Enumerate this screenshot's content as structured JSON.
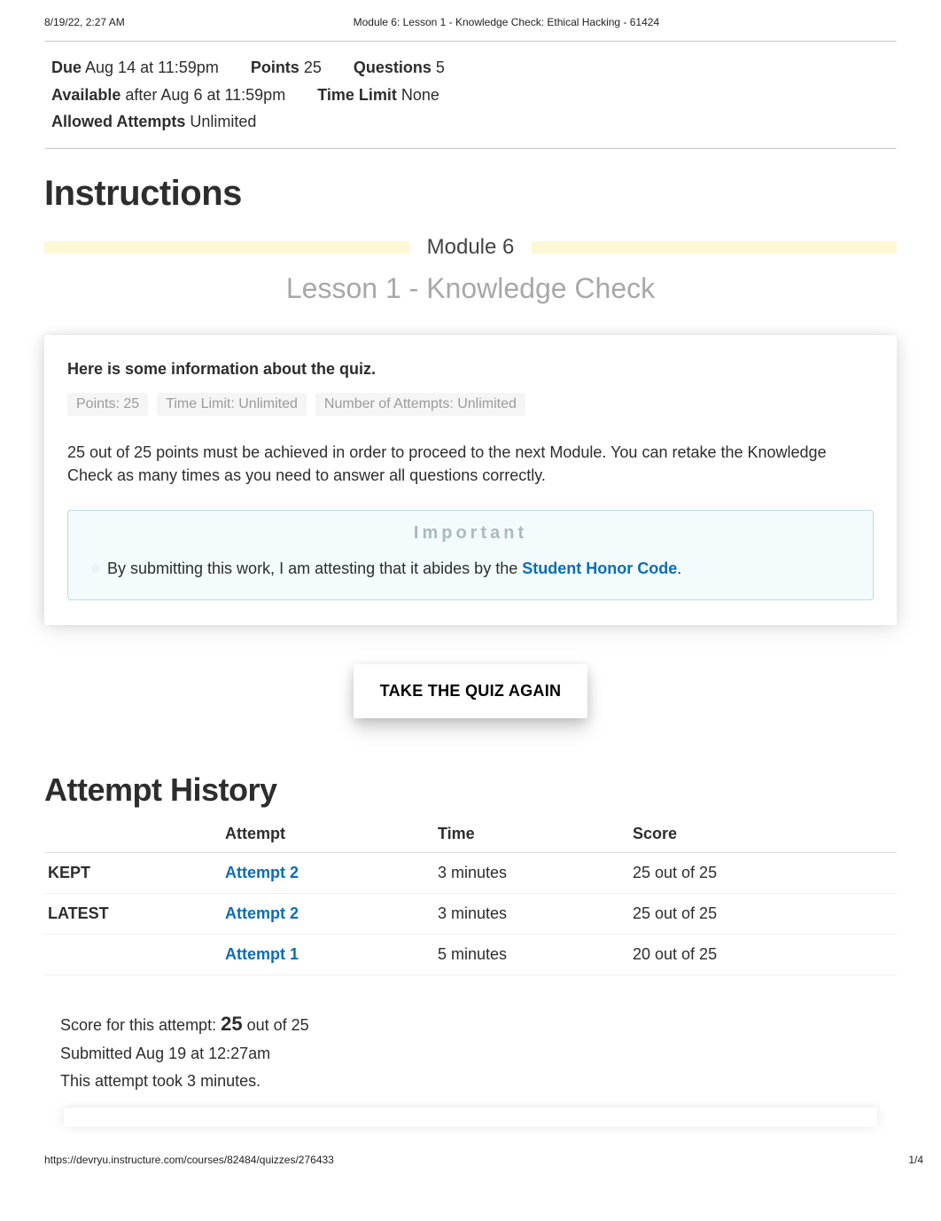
{
  "print": {
    "datetime": "8/19/22, 2:27 AM",
    "title": "Module 6: Lesson 1 - Knowledge Check: Ethical Hacking - 61424",
    "url": "https://devryu.instructure.com/courses/82484/quizzes/276433",
    "page": "1/4"
  },
  "meta": {
    "due_label": "Due",
    "due_value": "Aug 14 at 11:59pm",
    "points_label": "Points",
    "points_value": "25",
    "questions_label": "Questions",
    "questions_value": "5",
    "available_label": "Available",
    "available_value": "after Aug 6 at 11:59pm",
    "timelimit_label": "Time Limit",
    "timelimit_value": "None",
    "attempts_label": "Allowed Attempts",
    "attempts_value": "Unlimited"
  },
  "headings": {
    "instructions": "Instructions",
    "module": "Module 6",
    "lesson": "Lesson 1 - Knowledge Check",
    "history": "Attempt History"
  },
  "info": {
    "intro": "Here is some information about the quiz.",
    "pills": [
      "Points: 25",
      "Time Limit: Unlimited",
      "Number of Attempts: Unlimited"
    ],
    "para": "25 out of 25 points must be achieved in order to proceed to the next Module. You can retake the Knowledge Check as many times as you need to answer all questions correctly."
  },
  "important": {
    "title": "Important",
    "text_pre": "By submitting this work, I am attesting that it abides by the ",
    "link": "Student Honor Code",
    "text_post": "."
  },
  "button": {
    "take_again": "TAKE THE QUIZ AGAIN"
  },
  "table": {
    "headers": [
      "",
      "Attempt",
      "Time",
      "Score"
    ],
    "rows": [
      {
        "badge": "KEPT",
        "attempt": "Attempt 2",
        "time": "3 minutes",
        "score": "25 out of 25"
      },
      {
        "badge": "LATEST",
        "attempt": "Attempt 2",
        "time": "3 minutes",
        "score": "25 out of 25"
      },
      {
        "badge": "",
        "attempt": "Attempt 1",
        "time": "5 minutes",
        "score": "20 out of 25"
      }
    ]
  },
  "score_block": {
    "line1_pre": "Score for this attempt: ",
    "line1_big": "25",
    "line1_post": " out of 25",
    "line2": "Submitted Aug 19 at 12:27am",
    "line3": "This attempt took 3 minutes."
  }
}
